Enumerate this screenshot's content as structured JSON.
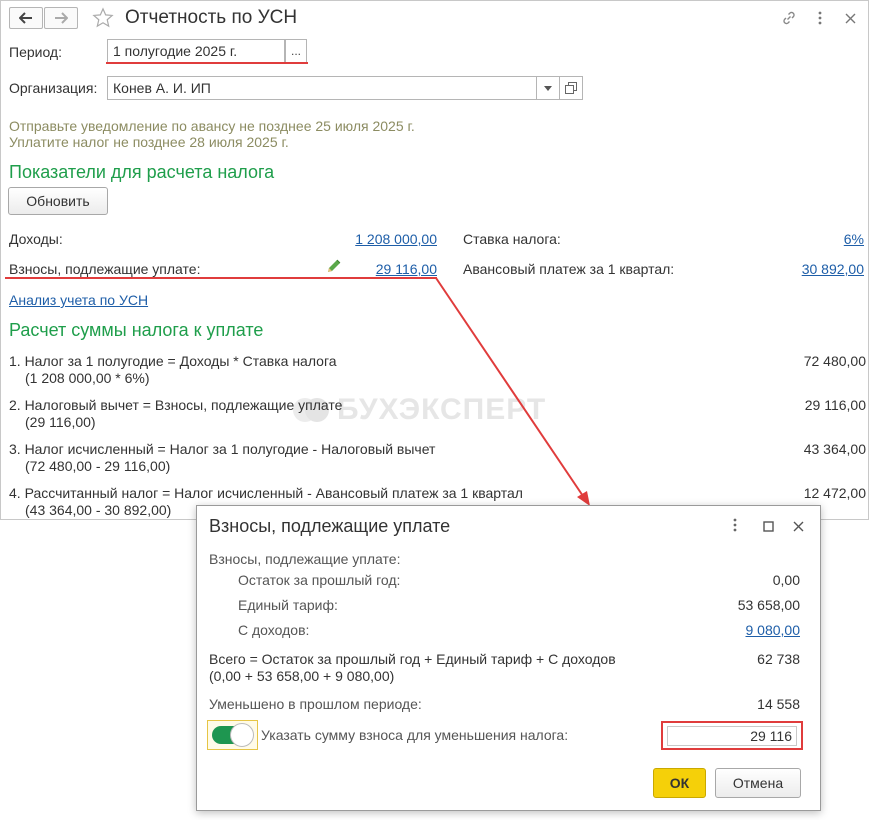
{
  "main": {
    "title": "Отчетность по УСН",
    "period": {
      "label": "Период:",
      "value": "1 полугодие 2025 г.",
      "button": "..."
    },
    "organization": {
      "label": "Организация:",
      "value": "Конев А. И. ИП"
    },
    "hints": [
      "Отправьте уведомление по авансу не позднее 25 июля 2025 г.",
      "Уплатите налог не позднее 28 июля 2025 г."
    ],
    "indicators_title": "Показатели для расчета налога",
    "refresh_button": "Обновить",
    "income": {
      "label": "Доходы:",
      "value": "1 208 000,00"
    },
    "rate": {
      "label": "Ставка налога:",
      "value": "6%"
    },
    "contributions": {
      "label": "Взносы, подлежащие уплате:",
      "value": "29 116,00"
    },
    "advance": {
      "label": "Авансовый платеж за 1 квартал:",
      "value": "30 892,00"
    },
    "analysis_link": "Анализ учета по УСН",
    "calc_title": "Расчет суммы налога к уплате",
    "calc": [
      {
        "text": "1. Налог за 1 полугодие = Доходы * Ставка налога",
        "sub": "(1 208 000,00 * 6%)",
        "value": "72 480,00"
      },
      {
        "text": "2. Налоговый вычет = Взносы, подлежащие уплате",
        "sub": "(29 116,00)",
        "value": "29 116,00"
      },
      {
        "text": "3. Налог исчисленный = Налог за 1 полугодие - Налоговый вычет",
        "sub": "(72 480,00 - 29 116,00)",
        "value": "43 364,00"
      },
      {
        "text": "4. Рассчитанный налог = Налог исчисленный - Авансовый платеж за 1 квартал",
        "sub": "(43 364,00 - 30 892,00)",
        "value": "12 472,00"
      }
    ],
    "watermark": "БУХЭКСПЕРТ"
  },
  "dialog": {
    "title": "Взносы, подлежащие уплате",
    "heading": "Взносы, подлежащие уплате:",
    "rows": [
      {
        "label": "Остаток за прошлый год:",
        "value": "0,00"
      },
      {
        "label": "Единый тариф:",
        "value": "53 658,00"
      },
      {
        "label": "С доходов:",
        "value": "9 080,00"
      }
    ],
    "total": {
      "text": "Всего = Остаток за прошлый год + Единый тариф + С доходов",
      "sub": "(0,00 + 53 658,00 + 9 080,00)",
      "value": "62 738"
    },
    "reduced": {
      "label": "Уменьшено в прошлом периоде:",
      "value": "14 558"
    },
    "toggle": {
      "label": "Указать сумму взноса для уменьшения налога:",
      "value": "29 116",
      "on": true
    },
    "ok": "ОК",
    "cancel": "Отмена"
  },
  "colors": {
    "accent_green": "#1f9e4b",
    "link": "#1e5ea8",
    "highlight_red": "#e03c3c",
    "ok_yellow": "#f5d009"
  }
}
